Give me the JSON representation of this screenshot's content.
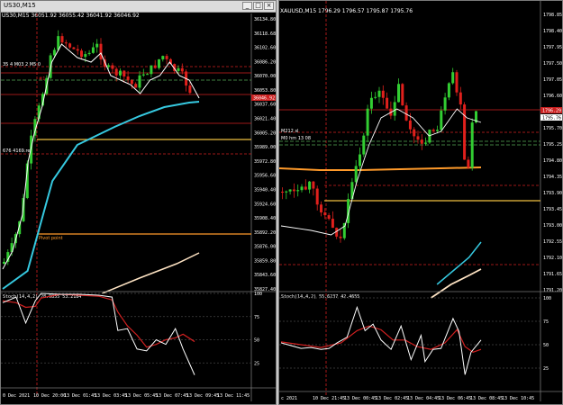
{
  "colors": {
    "bull": "#32cd32",
    "bear": "#e0201c",
    "ma_fast": "#ffffff",
    "ma_mid": "#36c9e0",
    "ma_slow": "#ffe4c4",
    "level_gold": "#f0c040",
    "level_orange": "#ff9a2a",
    "level_red": "#d02020",
    "stoch_main": "#ffffff",
    "stoch_signal": "#d02020"
  },
  "left": {
    "title": "US30,M15",
    "info": "US30,M15  36051.92 36055.42 36041.92 36046.92",
    "price_ticks": [
      "36134.80",
      "36118.68",
      "36102.60",
      "36086.20",
      "36070.00",
      "36053.80",
      "36037.60",
      "36021.40",
      "36005.20",
      "35989.00",
      "35972.80",
      "35956.60",
      "35940.40",
      "35924.60",
      "35908.40",
      "35892.20",
      "35876.00",
      "35859.80",
      "35843.60",
      "35827.40"
    ],
    "current_price": "36046.92",
    "level_labels": [
      "#1",
      "Pivot point",
      "35 4 M03 2 M5 0",
      "0.0000",
      "676 4169.re"
    ],
    "indicator_label": "Stoch(14,4,2) 28.9855 53.2184",
    "ind_ticks": [
      "100",
      "75",
      "50",
      "25"
    ],
    "time_labels": [
      "0 Dec 2021",
      "10 Dec 20:00",
      "13 Dec 01:45",
      "13 Dec 03:45",
      "13 Dec 05:45",
      "13 Dec 07:45",
      "13 Dec 09:45",
      "13 Dec 11:45"
    ],
    "ma_mid": [
      [
        0,
        38
      ],
      [
        0.05,
        35
      ],
      [
        0.1,
        30
      ],
      [
        0.15,
        25
      ],
      [
        0.2,
        21
      ],
      [
        0.3,
        18.5
      ],
      [
        0.4,
        17
      ],
      [
        0.5,
        16.5
      ],
      [
        0.6,
        16.8
      ],
      [
        0.7,
        17.5
      ],
      [
        0.8,
        18.5
      ],
      [
        0.9,
        19.8
      ],
      [
        1,
        21
      ]
    ],
    "stoch_main": [
      [
        0,
        90
      ],
      [
        0.07,
        96
      ],
      [
        0.12,
        68
      ],
      [
        0.17,
        92
      ],
      [
        0.2,
        100
      ],
      [
        0.3,
        99
      ],
      [
        0.4,
        99
      ],
      [
        0.5,
        98
      ],
      [
        0.57,
        96
      ],
      [
        0.6,
        60
      ],
      [
        0.65,
        62
      ],
      [
        0.7,
        40
      ],
      [
        0.75,
        38
      ],
      [
        0.8,
        50
      ],
      [
        0.85,
        45
      ],
      [
        0.9,
        62
      ],
      [
        0.94,
        40
      ],
      [
        1,
        12
      ]
    ],
    "stoch_signal": [
      [
        0,
        92
      ],
      [
        0.07,
        90
      ],
      [
        0.12,
        85
      ],
      [
        0.17,
        86
      ],
      [
        0.2,
        95
      ],
      [
        0.3,
        99
      ],
      [
        0.4,
        98
      ],
      [
        0.5,
        97
      ],
      [
        0.57,
        93
      ],
      [
        0.6,
        80
      ],
      [
        0.65,
        65
      ],
      [
        0.7,
        55
      ],
      [
        0.75,
        42
      ],
      [
        0.8,
        45
      ],
      [
        0.85,
        50
      ],
      [
        0.9,
        52
      ],
      [
        0.94,
        56
      ],
      [
        1,
        48
      ]
    ]
  },
  "right": {
    "title": "",
    "info": "XAUUSD,M15  1796.29 1796.57 1795.87 1795.76",
    "price_ticks": [
      "1798.85",
      "1798.40",
      "1797.95",
      "1797.50",
      "1797.05",
      "1796.60",
      "1796.15",
      "1795.70",
      "1795.25",
      "1794.80",
      "1794.35",
      "1793.90",
      "1793.45",
      "1793.00",
      "1792.55",
      "1792.10",
      "1791.65",
      "1791.20"
    ],
    "current_price": "1795.76",
    "current_price2": "1796.29",
    "level_labels": [
      "M212 sl",
      "M0 hm 13 08",
      "r@ 9 1795 Y"
    ],
    "indicator_label": "Stoch(14,4,2) 55.6237 42.4655",
    "ind_ticks": [
      "100",
      "75",
      "50",
      "25"
    ],
    "time_labels": [
      "c 2021",
      "10 Dec 21:45",
      "13 Dec 00:45",
      "13 Dec 02:45",
      "13 Dec 04:45",
      "13 Dec 06:45",
      "13 Dec 08:45",
      "13 Dec 10:45"
    ],
    "stoch_main": [
      [
        0,
        52
      ],
      [
        0.05,
        49
      ],
      [
        0.1,
        46
      ],
      [
        0.15,
        47
      ],
      [
        0.2,
        45
      ],
      [
        0.24,
        46
      ],
      [
        0.28,
        52
      ],
      [
        0.33,
        58
      ],
      [
        0.38,
        90
      ],
      [
        0.42,
        65
      ],
      [
        0.46,
        72
      ],
      [
        0.5,
        55
      ],
      [
        0.55,
        45
      ],
      [
        0.6,
        70
      ],
      [
        0.65,
        34
      ],
      [
        0.7,
        60
      ],
      [
        0.72,
        32
      ],
      [
        0.76,
        45
      ],
      [
        0.8,
        46
      ],
      [
        0.86,
        78
      ],
      [
        0.89,
        64
      ],
      [
        0.92,
        18
      ],
      [
        0.95,
        42
      ],
      [
        1,
        55
      ]
    ],
    "stoch_signal": [
      [
        0,
        53
      ],
      [
        0.1,
        50
      ],
      [
        0.2,
        47
      ],
      [
        0.3,
        52
      ],
      [
        0.38,
        65
      ],
      [
        0.44,
        70
      ],
      [
        0.5,
        66
      ],
      [
        0.56,
        55
      ],
      [
        0.62,
        55
      ],
      [
        0.68,
        48
      ],
      [
        0.75,
        45
      ],
      [
        0.82,
        52
      ],
      [
        0.88,
        66
      ],
      [
        0.92,
        48
      ],
      [
        0.96,
        42
      ],
      [
        1,
        45
      ]
    ]
  }
}
